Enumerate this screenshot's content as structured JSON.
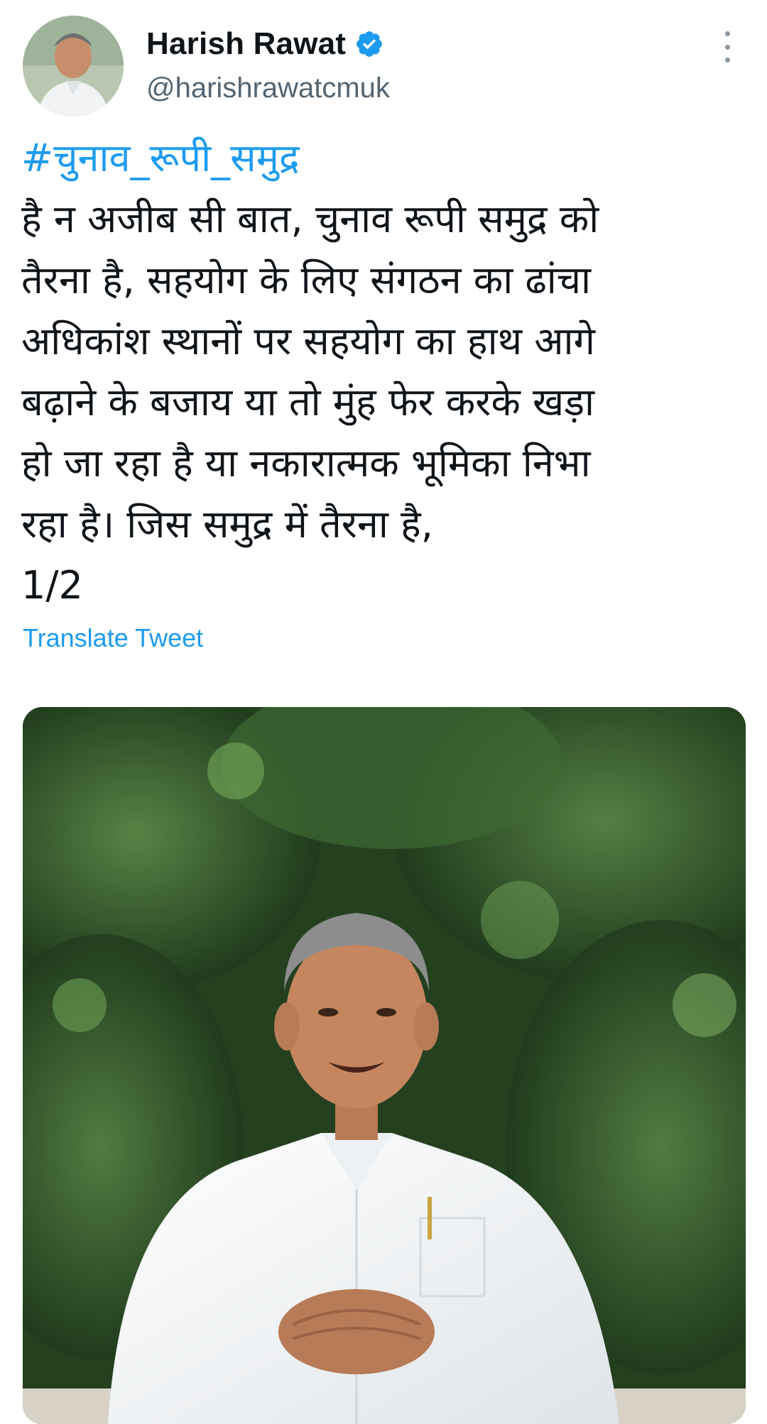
{
  "author": {
    "display_name": "Harish Rawat",
    "handle": "@harishrawatcmuk",
    "verified": true,
    "avatar_icon": "profile-photo"
  },
  "tweet": {
    "hashtag": "#चुनाव_रूपी_समुद्र",
    "lines": [
      "है न अजीब सी बात, चुनाव रूपी समुद्र को",
      "तैरना है, सहयोग के लिए संगठन का ढांचा",
      "अधिकांश स्थानों पर सहयोग का हाथ आगे",
      "बढ़ाने के बजाय या तो मुंह फेर करके खड़ा",
      "हो जा रहा है या नकारात्मक भूमिका निभा",
      "रहा है। जिस समुद्र में तैरना है,"
    ],
    "thread_counter": "1/2",
    "translate_label": "Translate Tweet"
  },
  "media": {
    "type": "photo",
    "icon": "photo-of-man-in-white-shirt"
  },
  "icons": {
    "verified": "verified-badge-icon",
    "more": "more-options-icon"
  },
  "colors": {
    "accent": "#1d9bf0",
    "text": "#0f1419",
    "secondary": "#536471"
  }
}
